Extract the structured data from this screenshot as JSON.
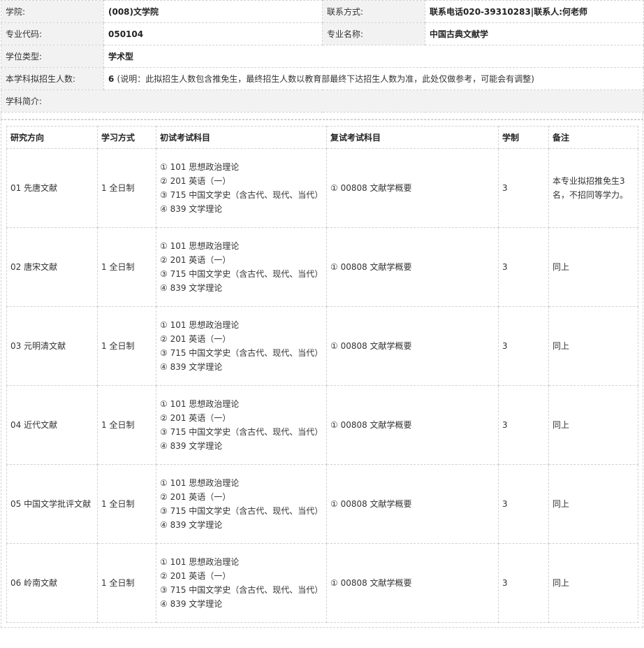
{
  "info": {
    "college_label": "学院:",
    "college_value": "(008)文学院",
    "contact_label": "联系方式:",
    "contact_value": "联系电话020-39310283|联系人:何老师",
    "major_code_label": "专业代码:",
    "major_code_value": "050104",
    "major_name_label": "专业名称:",
    "major_name_value": "中国古典文献学",
    "degree_type_label": "学位类型:",
    "degree_type_value": "学术型",
    "enroll_label": "本学科拟招生人数:",
    "enroll_value": "6",
    "enroll_note": "(说明：此拟招生人数包含推免生，最终招生人数以教育部最终下达招生人数为准，此处仅做参考，可能会有调整)",
    "intro_label": "学科简介:"
  },
  "plan": {
    "headers": [
      "研究方向",
      "学习方式",
      "初试考试科目",
      "复试考试科目",
      "学制",
      "备注"
    ],
    "rows": [
      {
        "direction": "01 先唐文献",
        "mode": "1 全日制",
        "exam": [
          "①  101  思想政治理论",
          "②  201  英语（一）",
          "③  715  中国文学史（含古代、现代、当代）",
          "④  839  文学理论"
        ],
        "retest": "①  00808  文献学概要",
        "years": "3",
        "note": "本专业拟招推免生3名，不招同等学力。"
      },
      {
        "direction": "02 唐宋文献",
        "mode": "1 全日制",
        "exam": [
          "①  101  思想政治理论",
          "②  201  英语（一）",
          "③  715  中国文学史（含古代、现代、当代）",
          "④  839  文学理论"
        ],
        "retest": "①  00808  文献学概要",
        "years": "3",
        "note": "同上"
      },
      {
        "direction": "03 元明清文献",
        "mode": "1 全日制",
        "exam": [
          "①  101  思想政治理论",
          "②  201  英语（一）",
          "③  715  中国文学史（含古代、现代、当代）",
          "④  839  文学理论"
        ],
        "retest": "①  00808  文献学概要",
        "years": "3",
        "note": "同上"
      },
      {
        "direction": "04 近代文献",
        "mode": "1 全日制",
        "exam": [
          "①  101  思想政治理论",
          "②  201  英语（一）",
          "③  715  中国文学史（含古代、现代、当代）",
          "④  839  文学理论"
        ],
        "retest": "①  00808  文献学概要",
        "years": "3",
        "note": "同上"
      },
      {
        "direction": "05 中国文学批评文献",
        "mode": "1 全日制",
        "exam": [
          "①  101  思想政治理论",
          "②  201  英语（一）",
          "③  715  中国文学史（含古代、现代、当代）",
          "④  839  文学理论"
        ],
        "retest": "①  00808  文献学概要",
        "years": "3",
        "note": "同上"
      },
      {
        "direction": "06 岭南文献",
        "mode": "1 全日制",
        "exam": [
          "①  101  思想政治理论",
          "②  201  英语（一）",
          "③  715  中国文学史（含古代、现代、当代）",
          "④  839  文学理论"
        ],
        "retest": "①  00808  文献学概要",
        "years": "3",
        "note": "同上"
      }
    ]
  }
}
